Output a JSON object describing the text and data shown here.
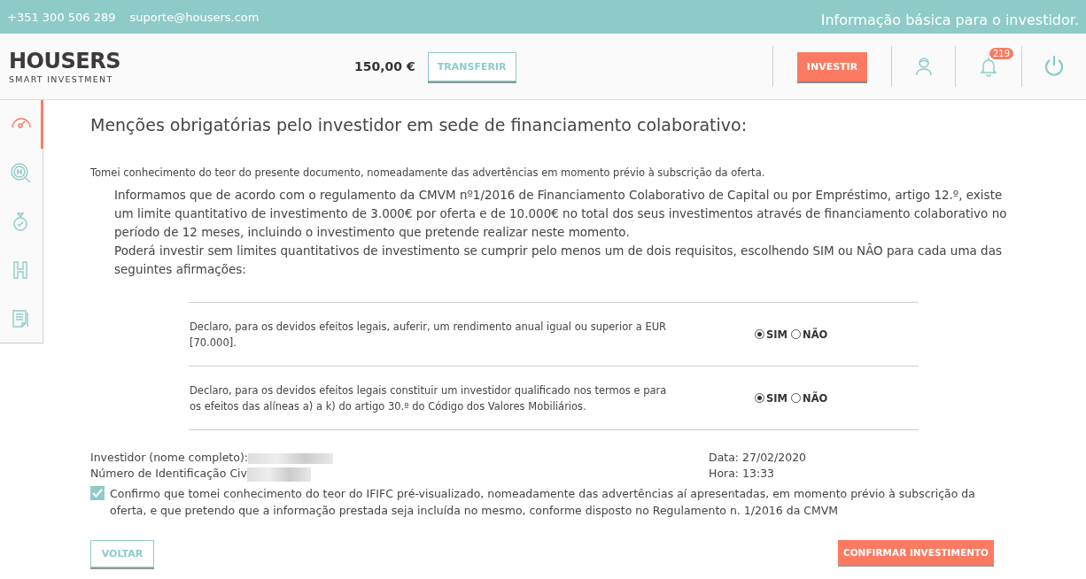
{
  "topbar": {
    "phone": "+351 300 506 289",
    "email": "suporte@housers.com",
    "info": "Informação básica para o investidor."
  },
  "header": {
    "logo": "HOUSERS",
    "tagline": "SMART INVESTMENT",
    "balance": "150,00 €",
    "transfer_button": "TRANSFERIR",
    "invest_button": "INVESTIR",
    "notification_count": "219"
  },
  "sidebar": {
    "items": [
      {
        "kind": "gauge",
        "selected": true
      },
      {
        "kind": "search",
        "selected": false
      },
      {
        "kind": "medal",
        "selected": false
      },
      {
        "kind": "letter",
        "selected": false
      },
      {
        "kind": "document",
        "selected": false
      }
    ]
  },
  "content": {
    "title": "Menções obrigatórias pelo investidor em sede de financiamento colaborativo:",
    "intro": "Tomei conhecimento do teor do presente documento, nomeadamente das advertências em momento prévio à subscrição da oferta.",
    "paragraphs": [
      "Informamos que de acordo com o regulamento da CMVM nº1/2016 de Financiamento Colaborativo de Capital ou por Empréstimo, artigo 12.º, existe um limite quantitativo de investimento de 3.000€ por oferta e de 10.000€ no total dos seus investimentos através de financiamento colaborativo no período de 12 meses, incluindo o investimento que pretende realizar neste momento.",
      "Poderá investir sem limites quantitativos de investimento se cumprir pelo menos um de dois requisitos, escolhendo SIM ou NÃO para cada uma das seguintes afirmações:"
    ],
    "declarations": [
      {
        "text": "Declaro, para os devidos efeitos legais, auferir, um rendimento anual igual ou superior a EUR [70.000].",
        "options": [
          {
            "label": "SIM",
            "selected": true
          },
          {
            "label": "NÃO",
            "selected": false
          }
        ]
      },
      {
        "text": "Declaro, para os devidos efeitos legais constituir um investidor qualificado nos termos e para os efeitos das alíneas a) a k) do artigo 30.º do Código dos Valores Mobiliários.",
        "options": [
          {
            "label": "SIM",
            "selected": true
          },
          {
            "label": "NÃO",
            "selected": false
          }
        ]
      }
    ],
    "investor_label": "Investidor (nome completo):",
    "id_label": "Número de Identificação Civ",
    "date": "Data: 27/02/2020",
    "time": "Hora: 13:33",
    "confirmation": {
      "checked": true,
      "text": "Confirmo que tomei conhecimento do teor do IFIFC pré-visualizado, nomeadamente das advertências aí apresentadas, em momento prévio à subscrição da oferta, e que pretendo que a informação prestada seja incluída no mesmo, conforme disposto no Regulamento n. 1/2016 da CMVM"
    },
    "back_button": "VOLTAR",
    "confirm_button": "CONFIRMAR INVESTIMENTO"
  }
}
